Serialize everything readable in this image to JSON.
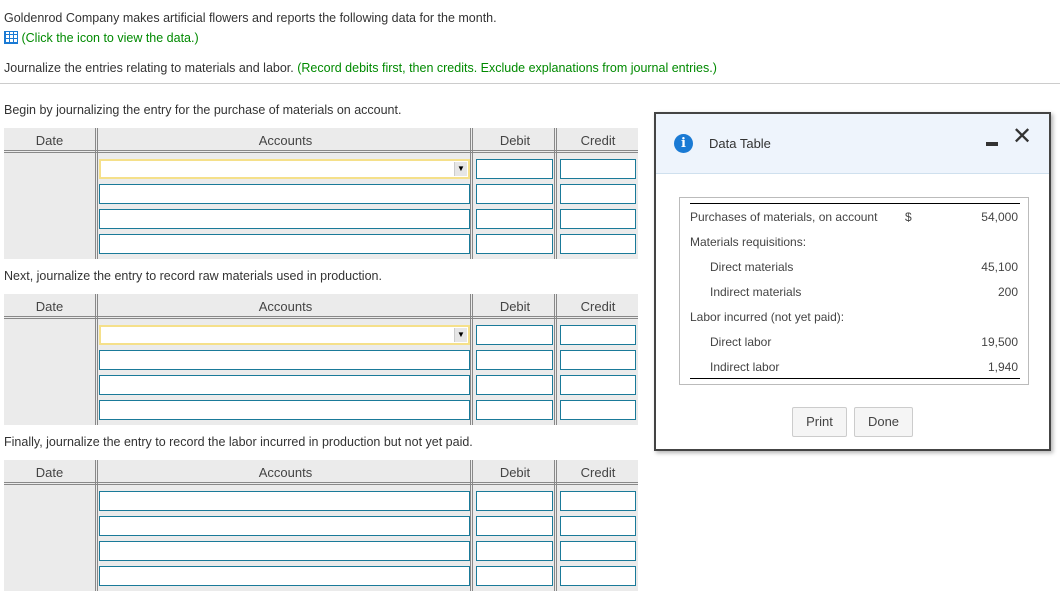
{
  "intro": "Goldenrod Company makes artificial flowers and reports the following data for the month.",
  "data_link": "(Click the icon to view the data.)",
  "instruction": "Journalize the entries relating to materials and labor.",
  "instruction_note": "(Record debits first, then credits. Exclude explanations from journal entries.)",
  "sections": [
    {
      "prompt": "Begin by journalizing the entry for the purchase of materials on account."
    },
    {
      "prompt": "Next, journalize the entry to record raw materials used in production."
    },
    {
      "prompt": "Finally, journalize the entry to record the labor incurred in production but not yet paid."
    }
  ],
  "columns": {
    "date": "Date",
    "accounts": "Accounts",
    "debit": "Debit",
    "credit": "Credit"
  },
  "modal": {
    "title": "Data Table",
    "rows": [
      {
        "label": "Purchases of materials, on account",
        "currency": "$",
        "value": "54,000"
      },
      {
        "label": "Materials requisitions:",
        "value": ""
      },
      {
        "label": "Direct materials",
        "value": "45,100"
      },
      {
        "label": "Indirect materials",
        "value": "200"
      },
      {
        "label": "Labor incurred (not yet paid):",
        "value": ""
      },
      {
        "label": "Direct labor",
        "value": "19,500"
      },
      {
        "label": "Indirect labor",
        "value": "1,940"
      }
    ],
    "print": "Print",
    "done": "Done"
  }
}
